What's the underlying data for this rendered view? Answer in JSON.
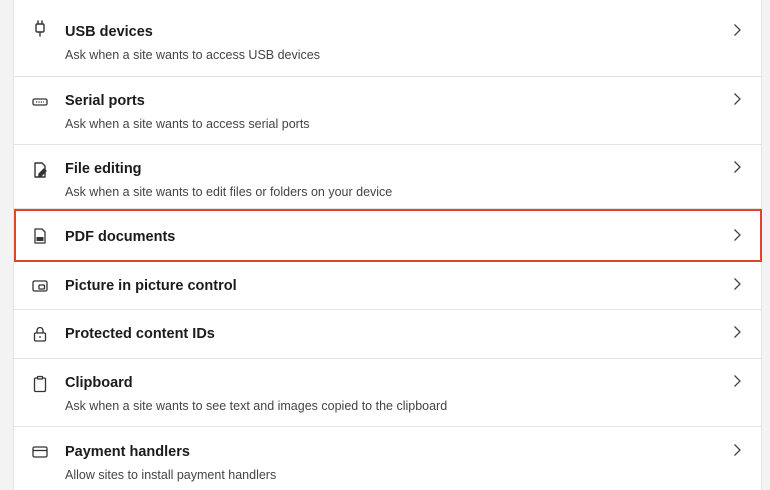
{
  "settings": {
    "items": [
      {
        "title": "USB devices",
        "description": "Ask when a site wants to access USB devices",
        "icon": "usb-icon"
      },
      {
        "title": "Serial ports",
        "description": "Ask when a site wants to access serial ports",
        "icon": "serial-port-icon"
      },
      {
        "title": "File editing",
        "description": "Ask when a site wants to edit files or folders on your device",
        "icon": "file-edit-icon"
      },
      {
        "title": "PDF documents",
        "description": "",
        "icon": "pdf-document-icon"
      },
      {
        "title": "Picture in picture control",
        "description": "",
        "icon": "picture-in-picture-icon"
      },
      {
        "title": "Protected content IDs",
        "description": "",
        "icon": "lock-icon"
      },
      {
        "title": "Clipboard",
        "description": "Ask when a site wants to see text and images copied to the clipboard",
        "icon": "clipboard-icon"
      },
      {
        "title": "Payment handlers",
        "description": "Allow sites to install payment handlers",
        "icon": "credit-card-icon"
      }
    ]
  },
  "colors": {
    "highlight": "#e0452c",
    "background": "#f3f3f3",
    "panel": "#ffffff"
  }
}
